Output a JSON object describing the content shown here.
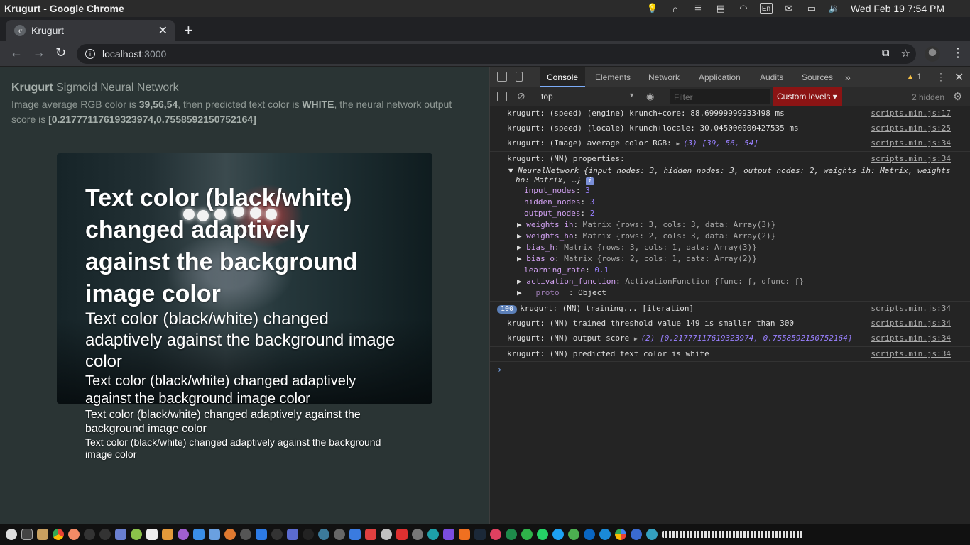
{
  "os": {
    "window_title": "Krugurt - Google Chrome",
    "indicators": [
      "lightbulb-icon",
      "headphones-icon",
      "notes-icon",
      "clipboard-icon",
      "wifi-icon",
      "keyboard-layout-icon",
      "mail-icon",
      "battery-icon",
      "volume-icon"
    ],
    "keyboard_layout": "En",
    "clock": "Wed Feb 19  7:54 PM"
  },
  "browser": {
    "tab_title": "Krugurt",
    "tab_favicon": "kr",
    "url_host": "localhost",
    "url_port": ":3000"
  },
  "page": {
    "heading_bold": "Krugurt",
    "heading_rest": " Sigmoid Neural Network",
    "desc_1": "Image average RGB color is ",
    "rgb": "39,56,54",
    "desc_2": ", then predicted text color is ",
    "predicted": "WHITE",
    "desc_3": ", the neural network output score is ",
    "score": "[0.21777117619323974,0.7558592150752164]",
    "adaptive_text": "Text color (black/white) changed adaptively against the background image color"
  },
  "devtools": {
    "tabs": [
      "Console",
      "Elements",
      "Network",
      "Application",
      "Audits",
      "Sources"
    ],
    "active_tab": "Console",
    "warning_count": "1",
    "context": "top",
    "filter_placeholder": "Filter",
    "levels": "Custom levels",
    "hidden": "2 hidden",
    "logs": [
      {
        "text": "krugurt: (speed) (engine) krunch+core: 88.69999999933498 ms",
        "src": "scripts.min.js:17"
      },
      {
        "text": "krugurt: (speed) (locale) krunch+locale: 30.045000000427535 ms",
        "src": "scripts.min.js:25"
      },
      {
        "text": "krugurt: (Image) average color RGB: ",
        "arr": "(3) [39, 56, 54]",
        "src": "scripts.min.js:34"
      },
      {
        "text": "krugurt: (NN) properties:",
        "src": "scripts.min.js:34"
      }
    ],
    "nn_summary_1": "NeuralNetwork {input_nodes: 3, hidden_nodes: 3, output_nodes: 2, weights_ih: Matrix, weights_",
    "nn_summary_2": "ho: Matrix, …}",
    "props": [
      {
        "k": "input_nodes",
        "v": "3"
      },
      {
        "k": "hidden_nodes",
        "v": "3"
      },
      {
        "k": "output_nodes",
        "v": "2"
      },
      {
        "k": "weights_ih",
        "t": "Matrix {rows: 3, cols: 3, data: Array(3)}"
      },
      {
        "k": "weights_ho",
        "t": "Matrix {rows: 2, cols: 3, data: Array(2)}"
      },
      {
        "k": "bias_h",
        "t": "Matrix {rows: 3, cols: 1, data: Array(3)}"
      },
      {
        "k": "bias_o",
        "t": "Matrix {rows: 2, cols: 1, data: Array(2)}"
      },
      {
        "k": "learning_rate",
        "v": "0.1"
      },
      {
        "k": "activation_function",
        "t": "ActivationFunction {func: ƒ, dfunc: ƒ}"
      },
      {
        "k": "__proto__",
        "t": "Object"
      }
    ],
    "logs2": [
      {
        "badge": "100",
        "text": "krugurt: (NN) training... [iteration]",
        "src": "scripts.min.js:34"
      },
      {
        "text": "krugurt: (NN) trained threshold value 149 is smaller than 300",
        "src": "scripts.min.js:34"
      },
      {
        "text": "krugurt: (NN) output score ",
        "arr": "(2) [0.21777117619323974, 0.7558592150752164]",
        "src": "scripts.min.js:34"
      },
      {
        "text": "krugurt: (NN) predicted text color is white",
        "src": "scripts.min.js:34"
      }
    ]
  },
  "colors": {
    "page_bg": "#2a3434",
    "devtools_bg": "#242424",
    "levels_bg": "#8b1414",
    "accent": "#7cacf8"
  }
}
